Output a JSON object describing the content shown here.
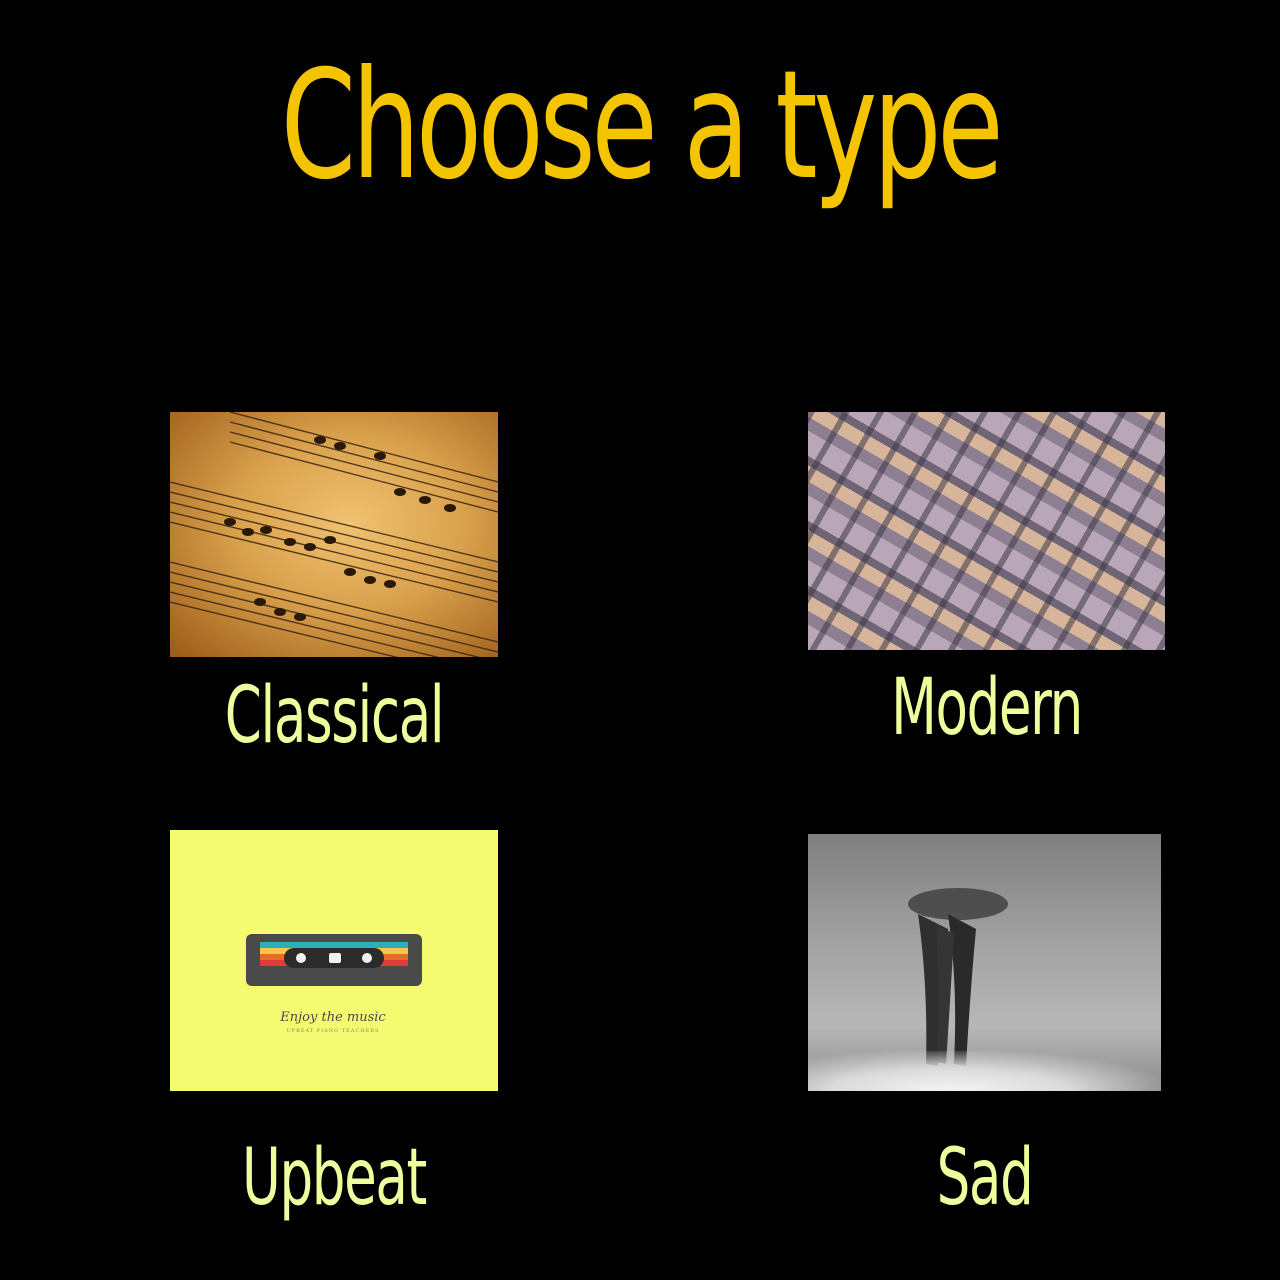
{
  "title": "Choose a type",
  "colors": {
    "background": "#000000",
    "title": "#f5c400",
    "label": "#ecff9c"
  },
  "types": [
    {
      "label": "Classical",
      "image": "sheet-music"
    },
    {
      "label": "Modern",
      "image": "geometric-facade"
    },
    {
      "label": "Upbeat",
      "image": "cassette-poster",
      "poster_text": "Enjoy the music",
      "poster_subtext": "UPBEAT PIANO TEACHERS"
    },
    {
      "label": "Sad",
      "image": "foggy-reflection"
    }
  ]
}
